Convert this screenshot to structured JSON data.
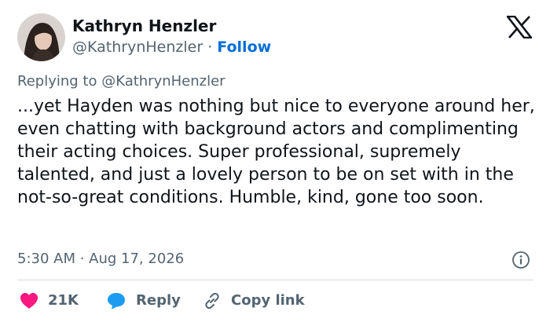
{
  "author": {
    "name": "Kathryn Henzler",
    "handle": "@KathrynHenzler",
    "separator": "·",
    "follow_label": "Follow"
  },
  "reply_context": "Replying to @KathrynHenzler",
  "tweet_text": "...yet Hayden was nothing but nice to everyone around her, even chatting with background actors and complimenting their acting choices. Super professional, supremely talented, and just a lovely person to be on set with in the not-so-great conditions. Humble, kind, gone too soon.",
  "timestamp": "5:30 AM · Aug 17, 2026",
  "actions": {
    "likes": "21K",
    "reply_label": "Reply",
    "copy_link_label": "Copy link"
  },
  "icons": {
    "brand": "x-logo-icon",
    "info": "info-icon",
    "like": "heart-icon",
    "reply": "speech-bubble-icon",
    "copy": "link-icon"
  },
  "colors": {
    "text": "#0f1419",
    "secondary": "#536471",
    "accent": "#006fd6",
    "like": "#f91880",
    "reply": "#1d9bf0",
    "divider": "#cfd9de"
  }
}
